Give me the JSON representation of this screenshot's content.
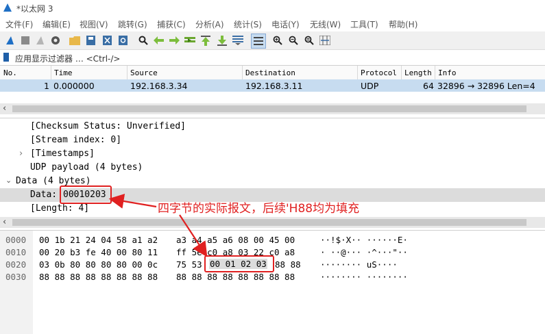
{
  "window": {
    "title": "*以太网 3"
  },
  "menu": [
    "文件(F)",
    "编辑(E)",
    "视图(V)",
    "跳转(G)",
    "捕获(C)",
    "分析(A)",
    "统计(S)",
    "电话(Y)",
    "无线(W)",
    "工具(T)",
    "帮助(H)"
  ],
  "toolbar": {
    "icons": [
      "shark-fin-start-icon",
      "stop-square-icon",
      "restart-fin-icon",
      "options-gear-icon",
      "open-folder-icon",
      "save-file-icon",
      "close-file-icon",
      "reload-icon",
      "find-magnifier-icon",
      "back-arrow-icon",
      "forward-arrow-icon",
      "go-to-packet-icon",
      "first-packet-icon",
      "last-packet-icon",
      "autoscroll-icon",
      "colorize-icon",
      "zoom-in-icon",
      "zoom-out-icon",
      "normal-size-icon",
      "resize-columns-icon"
    ]
  },
  "filter": {
    "placeholder": "应用显示过滤器 … <Ctrl-/>"
  },
  "packet_list": {
    "columns": [
      "No.",
      "Time",
      "Source",
      "Destination",
      "Protocol",
      "Length",
      "Info"
    ],
    "rows": [
      {
        "no": "1",
        "time": "0.000000",
        "source": "192.168.3.34",
        "destination": "192.168.3.11",
        "protocol": "UDP",
        "length": "64",
        "info": "32896 → 32896 Len=4"
      }
    ]
  },
  "details": {
    "checksum_status": "[Checksum Status: Unverified]",
    "stream_index": "[Stream index: 0]",
    "timestamps": "[Timestamps]",
    "udp_payload": "UDP payload (4 bytes)",
    "data_section": "Data (4 bytes)",
    "data_label": "Data: ",
    "data_value": "00010203",
    "length": "[Length: 4]"
  },
  "bytes": {
    "rows": [
      {
        "offset": "0000",
        "hex1": "00 1b 21 24 04 58 a1 a2",
        "hex2": "a3 a4 a5 a6 08 00 45 00",
        "ascii": "··!$·X·· ······E·"
      },
      {
        "offset": "0010",
        "hex1": "00 20 b3 fe 40 00 80 11",
        "hex2": "ff 5e c0 a8 03 22 c0 a8",
        "ascii": "· ··@··· ·^···\"··"
      },
      {
        "offset": "0020",
        "hex1": "03 0b 80 80 80 80 00 0c",
        "hex2": "75 53",
        "hex2_highlight": "00 01 02 03",
        "hex2_tail": "88 88",
        "ascii": "········ uS····  "
      },
      {
        "offset": "0030",
        "hex1": "88 88 88 88 88 88 88 88",
        "hex2": "88 88 88 88 88 88 88 88",
        "ascii": "········ ········"
      }
    ]
  },
  "annotation": {
    "text": "四字节的实际报文，后续'H88均为填充",
    "color": "#e02020"
  },
  "colors": {
    "selected_row": "#c7dcf0",
    "accent_red": "#e02020"
  }
}
